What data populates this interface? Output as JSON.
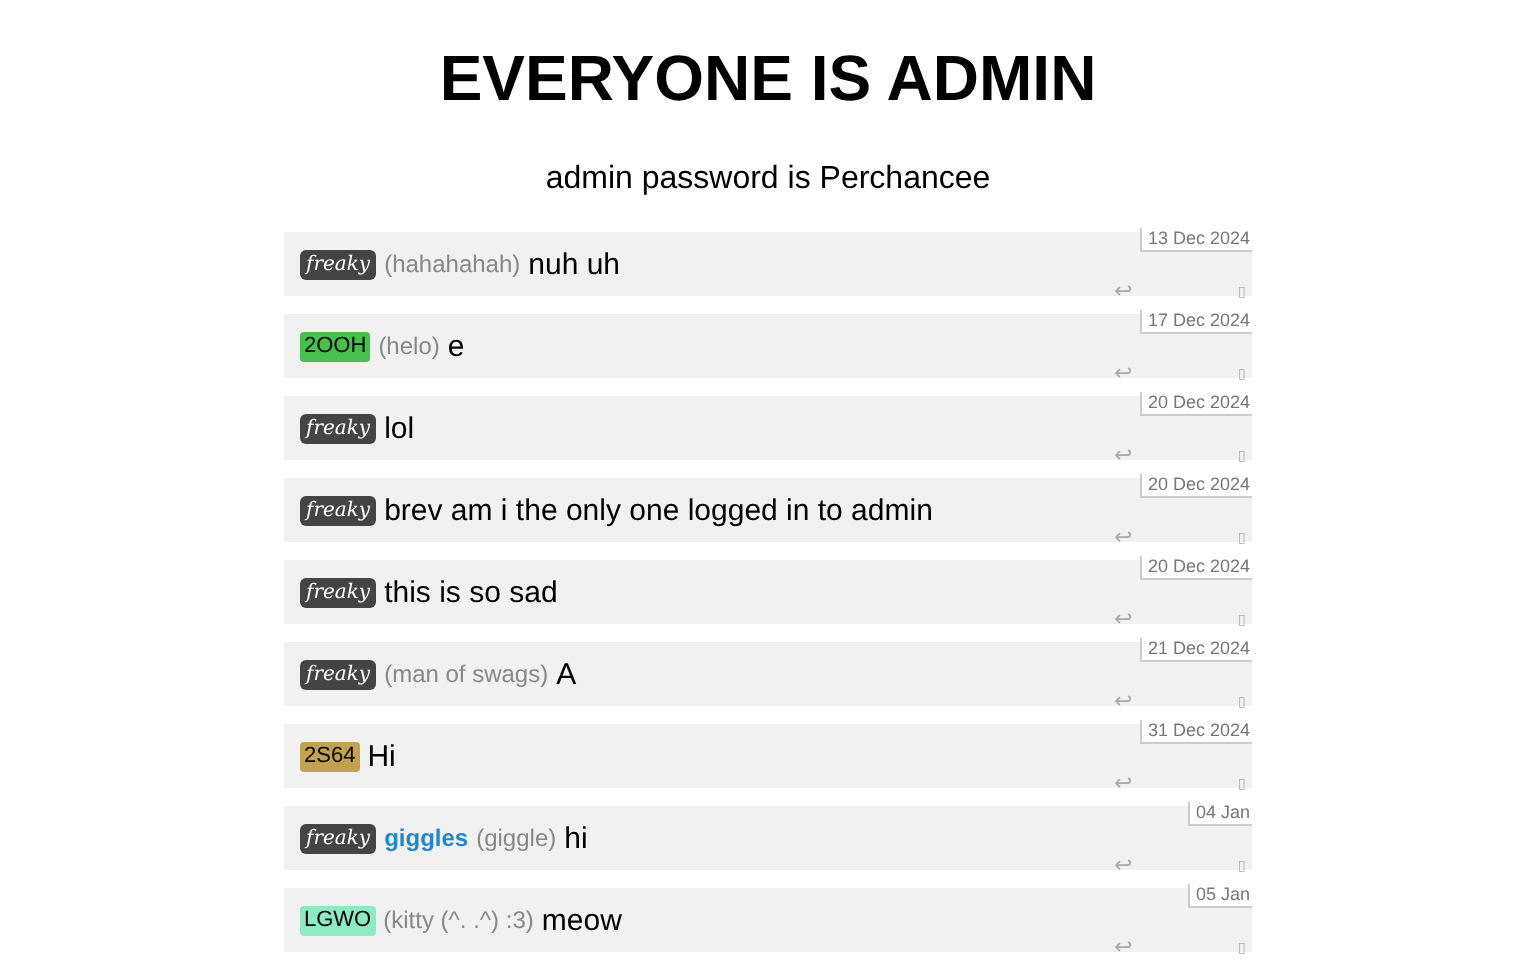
{
  "title": "EVERYONE IS ADMIN",
  "subtitle": "admin password is Perchancee",
  "messages": [
    {
      "badge": {
        "kind": "fancy",
        "text": "freaky",
        "color": "#444444"
      },
      "nickname": "(hahahahah)",
      "text": "nuh uh",
      "date": "13 Dec 2024",
      "reply": "↩",
      "mark": "▯"
    },
    {
      "badge": {
        "kind": "code",
        "text": "2OOH",
        "color": "#44c24c"
      },
      "nickname": "(helo)",
      "text": "e",
      "date": "17 Dec 2024",
      "reply": "↩",
      "mark": "▯"
    },
    {
      "badge": {
        "kind": "fancy",
        "text": "freaky",
        "color": "#444444"
      },
      "text": "lol",
      "date": "20 Dec 2024",
      "reply": "↩",
      "mark": "▯"
    },
    {
      "badge": {
        "kind": "fancy",
        "text": "freaky",
        "color": "#444444"
      },
      "text": "brev am i the only one logged in to admin",
      "date": "20 Dec 2024",
      "reply": "↩",
      "mark": "▯"
    },
    {
      "badge": {
        "kind": "fancy",
        "text": "freaky",
        "color": "#444444"
      },
      "text": "this is so sad",
      "date": "20 Dec 2024",
      "reply": "↩",
      "mark": "▯"
    },
    {
      "badge": {
        "kind": "fancy",
        "text": "freaky",
        "color": "#444444"
      },
      "nickname": "(man of swags)",
      "text": "A",
      "date": "21 Dec 2024",
      "reply": "↩",
      "mark": "▯"
    },
    {
      "badge": {
        "kind": "code",
        "text": "2S64",
        "color": "#c2a24c"
      },
      "text": "Hi",
      "date": "31 Dec 2024",
      "reply": "↩",
      "mark": "▯"
    },
    {
      "badge": {
        "kind": "fancy",
        "text": "freaky",
        "color": "#444444"
      },
      "name": "giggles",
      "nickname": "(giggle)",
      "text": "hi",
      "date": "04 Jan",
      "reply": "↩",
      "mark": "▯"
    },
    {
      "badge": {
        "kind": "code",
        "text": "LGWO",
        "color": "#8cebc4"
      },
      "nickname": "(kitty (^. .^) :3)",
      "text": "meow",
      "date": "05 Jan",
      "reply": "↩",
      "mark": "▯"
    }
  ]
}
